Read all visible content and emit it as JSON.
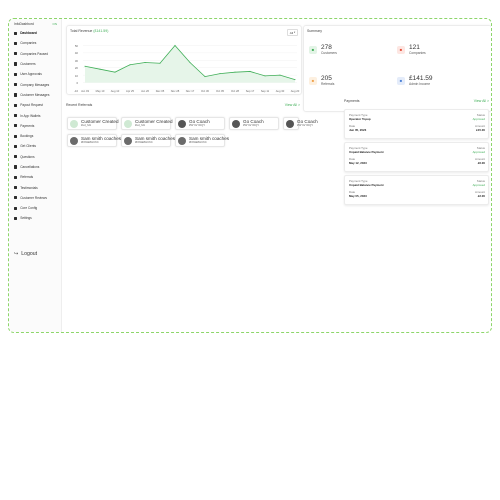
{
  "sidebar": {
    "brand": "InfoDashbord",
    "brand_badge": "ON",
    "items": [
      {
        "label": "Dashboard",
        "icon": "dashboard-icon"
      },
      {
        "label": "Companies",
        "icon": "building-icon"
      },
      {
        "label": "Companies Paused",
        "icon": "pause-icon"
      },
      {
        "label": "Customers",
        "icon": "users-icon"
      },
      {
        "label": "User Approvals",
        "icon": "user-check-icon"
      },
      {
        "label": "Company Messages",
        "icon": "message-icon"
      },
      {
        "label": "Customer Messages",
        "icon": "chat-icon"
      },
      {
        "label": "Payout Request",
        "icon": "payout-icon"
      },
      {
        "label": "In App Wallets",
        "icon": "wallet-icon"
      },
      {
        "label": "Payments",
        "icon": "card-icon"
      },
      {
        "label": "Bookings",
        "icon": "calendar-icon"
      },
      {
        "label": "Get Clients",
        "icon": "pin-icon"
      },
      {
        "label": "Questions",
        "icon": "question-icon"
      },
      {
        "label": "Cancellations",
        "icon": "cancel-icon"
      },
      {
        "label": "Referrals",
        "icon": "share-icon"
      },
      {
        "label": "Testimonials",
        "icon": "quote-icon"
      },
      {
        "label": "Customer Reviews",
        "icon": "star-icon"
      },
      {
        "label": "Core Config",
        "icon": "config-icon"
      },
      {
        "label": "Settings",
        "icon": "gear-icon"
      }
    ],
    "logout": "Logout"
  },
  "revenue": {
    "title_prefix": "Total Revenue",
    "title_value": "(£141.59)",
    "filter": "All"
  },
  "chart_data": {
    "type": "area",
    "categories": [
      "Jun 03",
      "May 10",
      "Aug 10",
      "Apr 25",
      "Jun 26",
      "Dec 05",
      "Nov 28",
      "Nov 17",
      "Oct 30",
      "Oct 05",
      "Oct 28",
      "Sep 17",
      "Sep 11",
      "Aug 30",
      "Aug 20"
    ],
    "values": [
      22,
      18,
      14,
      24,
      27,
      26,
      50,
      27,
      8,
      12,
      14,
      15,
      9,
      10,
      4
    ],
    "yticks": [
      0,
      10,
      20,
      30,
      40,
      50
    ],
    "ylim": [
      -10,
      60
    ],
    "ytick_labels": [
      "-10",
      "0",
      "10",
      "20",
      "30",
      "40",
      "50"
    ],
    "color": "#3fae57",
    "fill": "#e6f5e9",
    "grid": true
  },
  "summary": {
    "title": "Summary",
    "stats": [
      {
        "value": "278",
        "label": "Customers",
        "icon": "users-icon",
        "color": "#3fae57",
        "bg": "#e3f4e6"
      },
      {
        "value": "121",
        "label": "Companies",
        "icon": "building-icon",
        "color": "#e44e3a",
        "bg": "#fde6e2"
      },
      {
        "value": "205",
        "label": "Referrals",
        "icon": "share-icon",
        "color": "#f0a24b",
        "bg": "#fdf0e0"
      },
      {
        "value": "£141.59",
        "label": "Admin Income",
        "icon": "income-icon",
        "color": "#4a7fd6",
        "bg": "#e4ecfa"
      }
    ]
  },
  "referrals": {
    "title": "Recent Referrals",
    "view_all": "View All >",
    "items": [
      {
        "name": "Customer Created",
        "sub": "#sd_fd1",
        "avatar": "avatar-icon"
      },
      {
        "name": "Customer Created",
        "sub": "#sd_fd1",
        "avatar": "avatar-icon"
      },
      {
        "name": "Go Coach",
        "sub": "#WYGYDQY",
        "avatar": "avatar-icon"
      },
      {
        "name": "Go Coach",
        "sub": "#WYGYDQY",
        "avatar": "avatar-icon"
      },
      {
        "name": "Go Coach",
        "sub": "#WYGYDQY",
        "avatar": "avatar-icon"
      },
      {
        "name": "Sam smith coaches",
        "sub": "#F8AE8HC6C",
        "avatar": "avatar-icon"
      },
      {
        "name": "Sam smith coaches",
        "sub": "#F8AE8HC6C",
        "avatar": "avatar-icon"
      },
      {
        "name": "Sam smith coaches",
        "sub": "#F8AE8HC6C",
        "avatar": "avatar-icon"
      }
    ]
  },
  "payments": {
    "title": "Payments",
    "view_all": "View All >",
    "labels": {
      "type": "Payment Type",
      "status": "Status",
      "date": "Date",
      "amount": "Amount"
    },
    "items": [
      {
        "type": "Operator Topup",
        "status": "Approved",
        "date": "Jun 05, 2023",
        "amount": "£15.00"
      },
      {
        "type": "Unpaid Balance Payment",
        "status": "Approved",
        "date": "May 12, 2023",
        "amount": "£6.00"
      },
      {
        "type": "Unpaid Balance Payment",
        "status": "Approved",
        "date": "May 05, 2023",
        "amount": "£2.00"
      }
    ]
  }
}
